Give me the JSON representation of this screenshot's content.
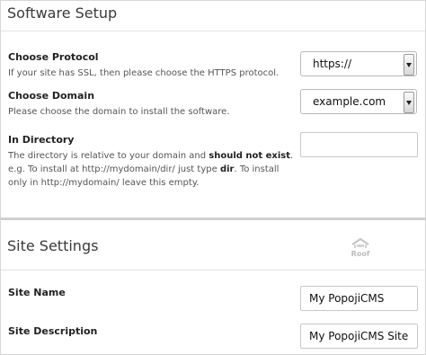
{
  "software_setup": {
    "title": "Software Setup",
    "protocol": {
      "label": "Choose Protocol",
      "description": "If your site has SSL, then please choose the HTTPS protocol.",
      "value": "https://"
    },
    "domain": {
      "label": "Choose Domain",
      "description": "Please choose the domain to install the software.",
      "value": "example.com"
    },
    "directory": {
      "label": "In Directory",
      "desc_part1": "The directory is relative to your domain and ",
      "desc_bold1": "should not exist",
      "desc_part2": ". e.g. To install at http://mydomain/dir/ just type ",
      "desc_bold2": "dir",
      "desc_part3": ". To install only in http://mydomain/ leave this empty.",
      "value": ""
    }
  },
  "site_settings": {
    "title": "Site Settings",
    "logo_text": "Roof",
    "site_name": {
      "label": "Site Name",
      "value": "My PopojiCMS"
    },
    "site_description": {
      "label": "Site Description",
      "value": "My PopojiCMS Site"
    }
  }
}
